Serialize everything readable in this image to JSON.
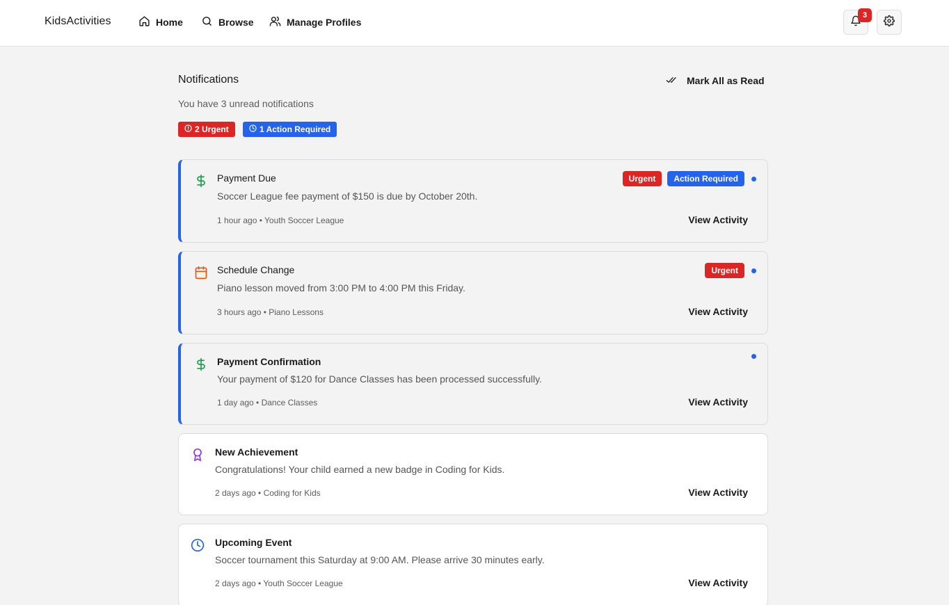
{
  "app": {
    "title": "KidsActivities"
  },
  "nav": {
    "home": "Home",
    "browse": "Browse",
    "profiles": "Manage Profiles"
  },
  "header": {
    "notification_count": "3",
    "icons": [
      "bell-icon",
      "gear-icon"
    ]
  },
  "page": {
    "title": "Notifications",
    "mark_all": "Mark All as Read",
    "unread_text": "You have 3 unread notifications",
    "urgent_pill": "2 Urgent",
    "action_pill": "1 Action Required"
  },
  "colors": {
    "urgent": "#dc2626",
    "action": "#2563eb",
    "payment_icon": "#16a34a",
    "schedule_icon": "#ea580c",
    "achievement_icon": "#9333ea",
    "event_icon": "#2563eb"
  },
  "notifications": [
    {
      "icon": "dollar-icon",
      "title": "Payment Due",
      "message": "Soccer League fee payment of $150 is due by October 20th.",
      "meta": "1 hour ago • Youth Soccer League",
      "badges": [
        "Urgent",
        "Action Required"
      ],
      "unread": true,
      "link": "View Activity"
    },
    {
      "icon": "calendar-icon",
      "title": "Schedule Change",
      "message": "Piano lesson moved from 3:00 PM to 4:00 PM this Friday.",
      "meta": "3 hours ago • Piano Lessons",
      "badges": [
        "Urgent"
      ],
      "unread": true,
      "link": "View Activity"
    },
    {
      "icon": "dollar-icon",
      "title": "Payment Confirmation",
      "message": "Your payment of $120 for Dance Classes has been processed successfully.",
      "meta": "1 day ago • Dance Classes",
      "badges": [],
      "unread": true,
      "link": "View Activity"
    },
    {
      "icon": "award-icon",
      "title": "New Achievement",
      "message": "Congratulations! Your child earned a new badge in Coding for Kids.",
      "meta": "2 days ago • Coding for Kids",
      "badges": [],
      "unread": false,
      "link": "View Activity"
    },
    {
      "icon": "clock-icon",
      "title": "Upcoming Event",
      "message": "Soccer tournament this Saturday at 9:00 AM. Please arrive 30 minutes early.",
      "meta": "2 days ago • Youth Soccer League",
      "badges": [],
      "unread": false,
      "link": "View Activity"
    }
  ]
}
